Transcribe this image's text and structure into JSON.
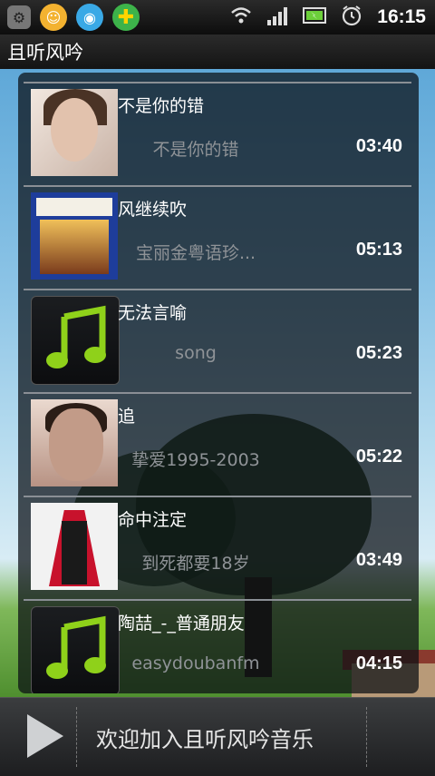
{
  "status_bar": {
    "time": "16:15",
    "icons": [
      "settings-icon",
      "chat-notification-icon",
      "qq-icon",
      "plus-app-icon",
      "wifi-icon",
      "signal-icon",
      "battery-icon",
      "alarm-icon"
    ]
  },
  "app": {
    "title": "且听风吟"
  },
  "songs": [
    {
      "title": "不是你的错",
      "subtitle": "不是你的错",
      "duration": "03:40"
    },
    {
      "title": "风继续吹",
      "subtitle": "宝丽金粤语珍...",
      "duration": "05:13"
    },
    {
      "title": "无法言喻",
      "subtitle": "song",
      "duration": "05:23"
    },
    {
      "title": "追",
      "subtitle": "挚爱1995-2003",
      "duration": "05:22"
    },
    {
      "title": "命中注定",
      "subtitle": "到死都要18岁",
      "duration": "03:49"
    },
    {
      "title": "陶喆_-_普通朋友",
      "subtitle": "easydoubanfm",
      "duration": "04:15"
    }
  ],
  "player": {
    "now_playing": "欢迎加入且听风吟音乐"
  },
  "colors": {
    "accent_note_green": "#8fd11a",
    "time_text": "#ffffff"
  }
}
